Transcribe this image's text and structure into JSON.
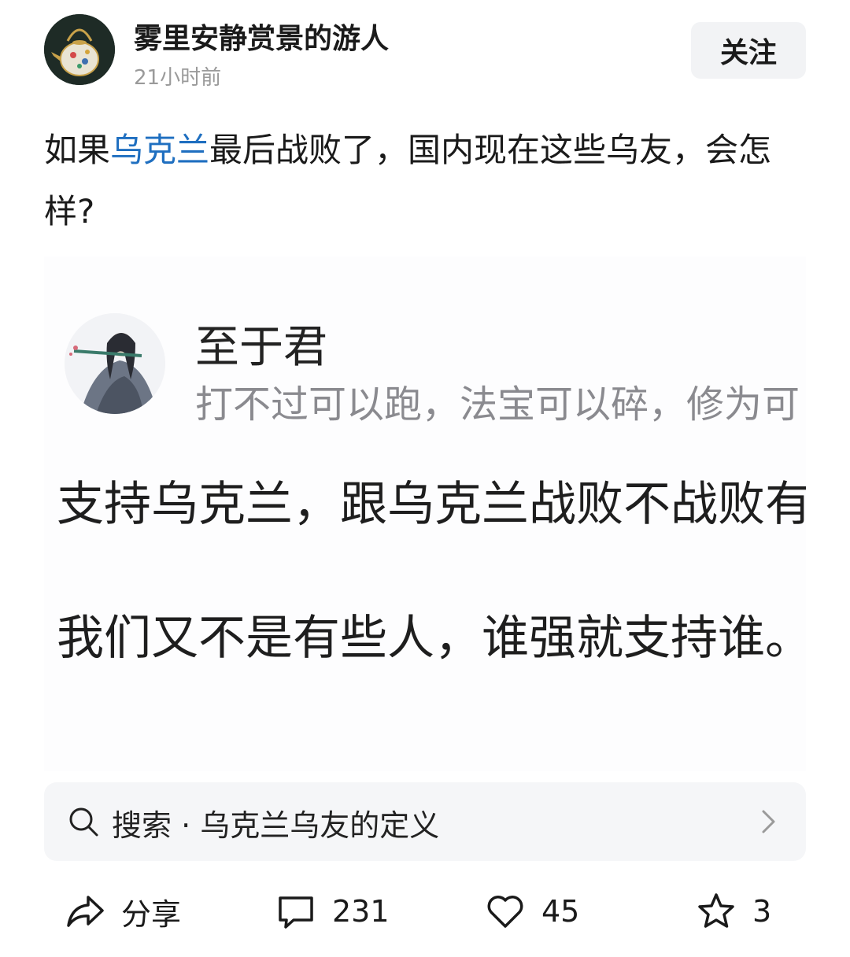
{
  "header": {
    "author_name": "雾里安静赏景的游人",
    "post_time": "21小时前",
    "follow_label": "关注",
    "avatar_icon": "teapot-avatar-icon"
  },
  "post": {
    "text_before": "如果",
    "link_text": "乌克兰",
    "text_after": "最后战败了，国内现在这些乌友，会怎样?",
    "link_color": "#1f6fc0"
  },
  "embedded_image": {
    "name": "至于君",
    "bio": "打不过可以跑，法宝可以碎，修为可",
    "line1": "支持乌克兰，跟乌克兰战败不战败有",
    "line2": "我们又不是有些人，谁强就支持谁。",
    "avatar_icon": "flute-player-avatar-icon"
  },
  "search": {
    "text": "搜索 · 乌克兰乌友的定义",
    "icon": "search-icon",
    "chevron": "chevron-right-icon"
  },
  "actions": {
    "share_label": "分享",
    "comment_count": "231",
    "like_count": "45",
    "favorite_count": "3"
  }
}
